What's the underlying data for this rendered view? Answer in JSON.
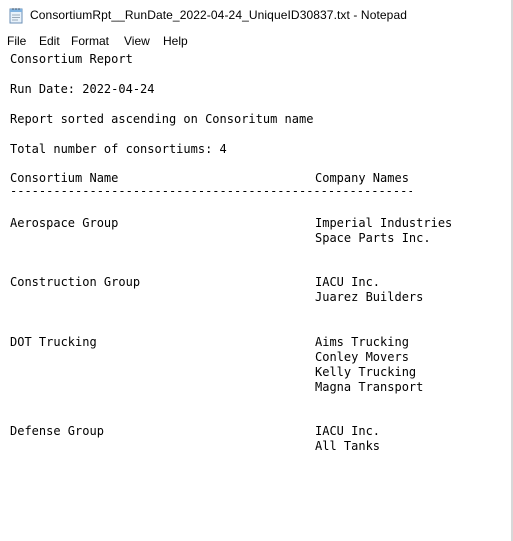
{
  "window": {
    "title": "ConsortiumRpt__RunDate_2022-04-24_UniqueID30837.txt - Notepad",
    "app_icon": "notepad-icon"
  },
  "menu": {
    "file": "File",
    "edit": "Edit",
    "format": "Format",
    "view": "View",
    "help": "Help"
  },
  "report": {
    "heading": "Consortium Report",
    "run_date": "Run Date: 2022-04-24",
    "sort_note": "Report sorted ascending on Consoritum name",
    "total": "Total number of consortiums: 4",
    "col_name_header": "Consortium Name",
    "col_company_header": "Company Names",
    "divider": "------------------------------------------------------------------",
    "consortiums": [
      {
        "name": "Aerospace Group",
        "companies": [
          "Imperial Industries",
          "Space Parts Inc."
        ]
      },
      {
        "name": "Construction Group",
        "companies": [
          "IACU Inc.",
          "Juarez Builders"
        ]
      },
      {
        "name": "DOT Trucking",
        "companies": [
          "Aims Trucking",
          "Conley Movers",
          "Kelly Trucking",
          "Magna Transport"
        ]
      },
      {
        "name": "Defense Group",
        "companies": [
          "IACU Inc.",
          "All Tanks"
        ]
      }
    ]
  }
}
